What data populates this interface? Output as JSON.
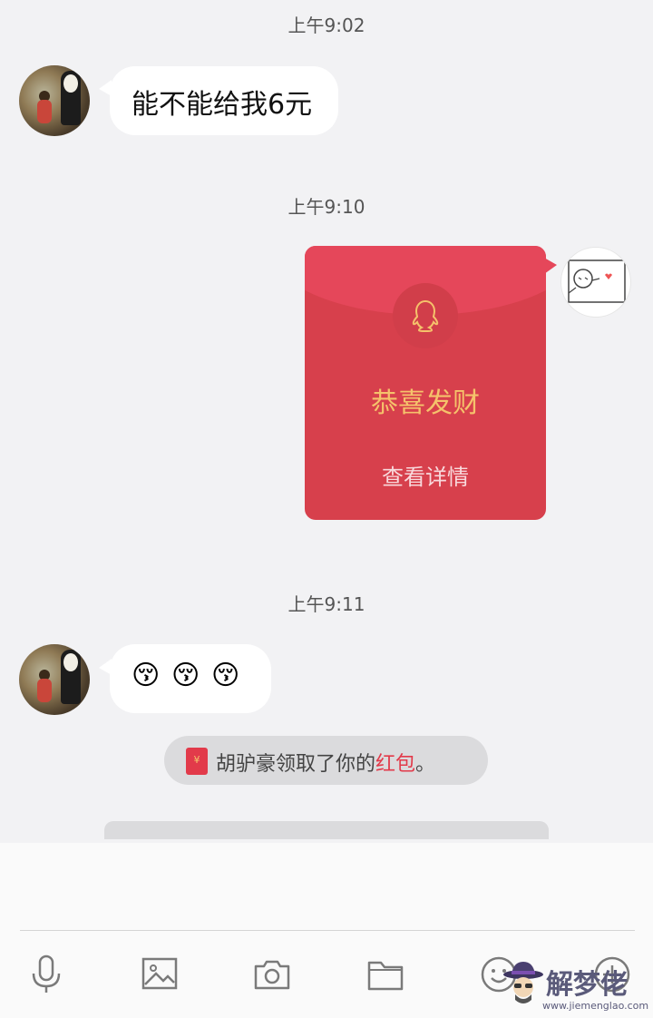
{
  "messages": {
    "ts1": "上午9:02",
    "msg1_text": "能不能给我6元",
    "ts2": "上午9:10",
    "redpacket": {
      "title": "恭喜发财",
      "subtitle": "查看详情"
    },
    "ts3": "上午9:11",
    "emojis": [
      "😚",
      "😚",
      "😚"
    ],
    "system_notice": {
      "icon_glyph": "¥",
      "prefix": "胡驴豪领取了你的",
      "link_text": "红包",
      "suffix": "。"
    }
  },
  "toolbar": {
    "icons": [
      "microphone-icon",
      "image-icon",
      "camera-icon",
      "folder-icon",
      "emoji-icon",
      "add-icon"
    ]
  },
  "watermark": {
    "name": "解梦佬",
    "url": "www.jiemenglao.com"
  },
  "colors": {
    "background": "#f2f2f4",
    "redpacket": "#d7404c",
    "redpacket_flap": "#e5475a",
    "redpacket_title": "#f5c26b",
    "link_red": "#e23a4a"
  }
}
